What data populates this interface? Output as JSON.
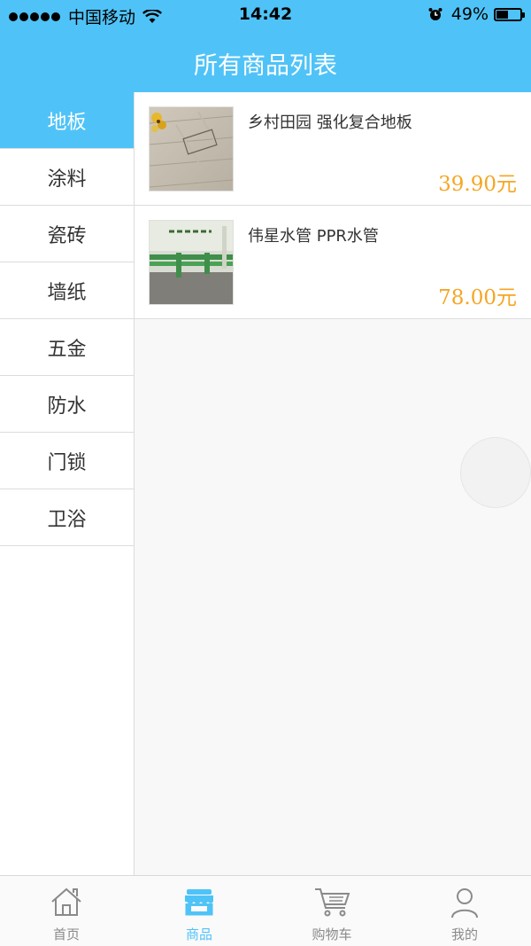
{
  "status_bar": {
    "carrier": "中国移动",
    "time": "14:42",
    "battery": "49%",
    "battery_level": 0.49
  },
  "header": {
    "title": "所有商品列表"
  },
  "sidebar": {
    "items": [
      {
        "label": "地板"
      },
      {
        "label": "涂料"
      },
      {
        "label": "瓷砖"
      },
      {
        "label": "墙纸"
      },
      {
        "label": "五金"
      },
      {
        "label": "防水"
      },
      {
        "label": "门锁"
      },
      {
        "label": "卫浴"
      }
    ]
  },
  "products": [
    {
      "name": "乡村田园 强化复合地板",
      "price": "39.90元"
    },
    {
      "name": "伟星水管 PPR水管",
      "price": "78.00元"
    }
  ],
  "tabs": [
    {
      "label": "首页",
      "icon": "home-icon"
    },
    {
      "label": "商品",
      "icon": "shop-icon"
    },
    {
      "label": "购物车",
      "icon": "cart-icon"
    },
    {
      "label": "我的",
      "icon": "user-icon"
    }
  ],
  "colors": {
    "accent": "#4fc3f7",
    "price": "#f5a623"
  }
}
